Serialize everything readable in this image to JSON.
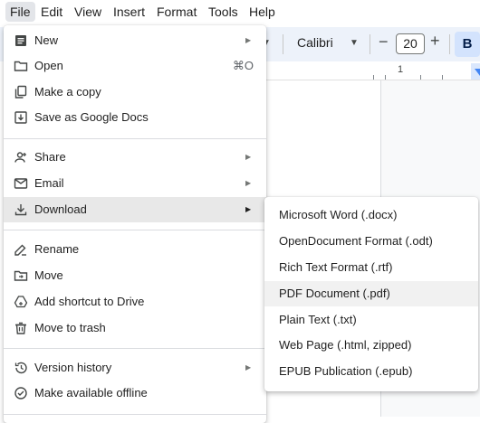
{
  "menubar": {
    "items": [
      {
        "label": "File"
      },
      {
        "label": "Edit"
      },
      {
        "label": "View"
      },
      {
        "label": "Insert"
      },
      {
        "label": "Format"
      },
      {
        "label": "Tools"
      },
      {
        "label": "Help"
      }
    ]
  },
  "toolbar": {
    "font_name": "Calibri",
    "font_size": "20",
    "minus": "−",
    "plus": "+",
    "bold": "B"
  },
  "ruler": {
    "number": "1"
  },
  "file_menu": {
    "items": [
      {
        "label": "New",
        "icon": "document-icon"
      },
      {
        "label": "Open",
        "icon": "folder-icon",
        "shortcut": "⌘O"
      },
      {
        "label": "Make a copy",
        "icon": "copy-icon"
      },
      {
        "label": "Save as Google Docs",
        "icon": "save-download-icon"
      },
      {
        "label": "Share",
        "icon": "person-add-icon"
      },
      {
        "label": "Email",
        "icon": "email-icon"
      },
      {
        "label": "Download",
        "icon": "download-icon"
      },
      {
        "label": "Rename",
        "icon": "rename-icon"
      },
      {
        "label": "Move",
        "icon": "folder-move-icon"
      },
      {
        "label": "Add shortcut to Drive",
        "icon": "drive-shortcut-icon"
      },
      {
        "label": "Move to trash",
        "icon": "trash-icon"
      },
      {
        "label": "Version history",
        "icon": "history-icon"
      },
      {
        "label": "Make available offline",
        "icon": "offline-icon"
      }
    ]
  },
  "download_submenu": {
    "items": [
      {
        "label": "Microsoft Word (.docx)"
      },
      {
        "label": "OpenDocument Format (.odt)"
      },
      {
        "label": "Rich Text Format (.rtf)"
      },
      {
        "label": "PDF Document (.pdf)"
      },
      {
        "label": "Plain Text (.txt)"
      },
      {
        "label": "Web Page (.html, zipped)"
      },
      {
        "label": "EPUB Publication (.epub)"
      }
    ]
  },
  "colors": {
    "toolbar_bg": "#edf2fa",
    "bold_active": "#d3e3fd",
    "menu_highlight": "#e8e8e8"
  }
}
